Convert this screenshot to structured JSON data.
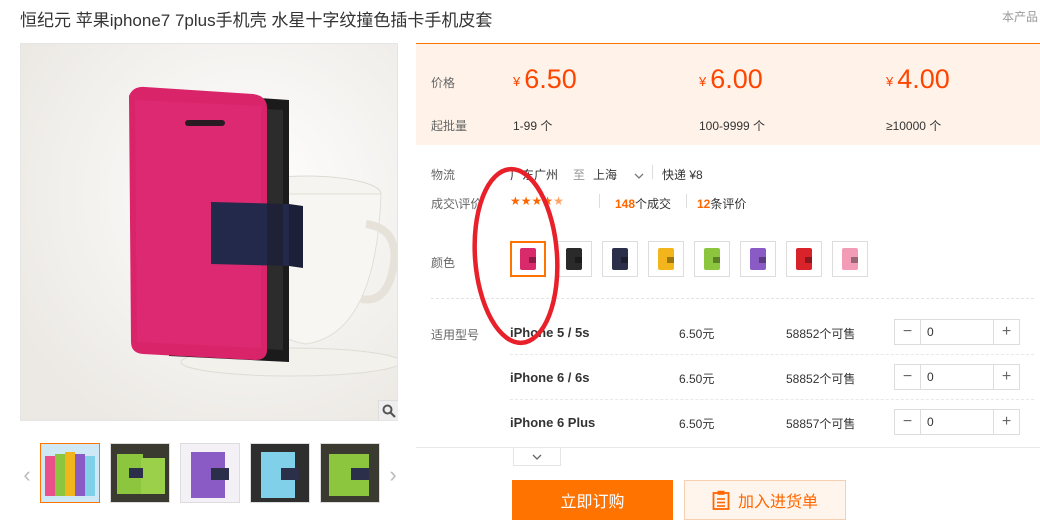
{
  "title": "恒纪元 苹果iphone7 7plus手机壳 水星十字纹撞色插卡手机皮套",
  "top_link": "本产品",
  "price_label": "价格",
  "moq_label": "起批量",
  "tiers": [
    {
      "currency": "¥",
      "price": "6.50",
      "qty": "1-99 个"
    },
    {
      "currency": "¥",
      "price": "6.00",
      "qty": "100-9999 个"
    },
    {
      "currency": "¥",
      "price": "4.00",
      "qty": "≥10000 个"
    }
  ],
  "logistics": {
    "label": "物流",
    "origin": "广东广州",
    "to": "至",
    "destination": "上海",
    "shipping": "快递 ¥8"
  },
  "rating": {
    "label": "成交\\评价",
    "stars": 4.5,
    "deals_num": "148",
    "deals_suffix": "个成交",
    "reviews_num": "12",
    "reviews_suffix": "条评价"
  },
  "color_label": "颜色",
  "swatches": [
    {
      "name": "rose",
      "color": "#d92a6b",
      "selected": true
    },
    {
      "name": "black",
      "color": "#2a2a2a"
    },
    {
      "name": "navy",
      "color": "#2b2f4a"
    },
    {
      "name": "yellow",
      "color": "#f2b51b"
    },
    {
      "name": "green",
      "color": "#8cc63f"
    },
    {
      "name": "purple",
      "color": "#8a5bc4"
    },
    {
      "name": "red",
      "color": "#d8232a"
    },
    {
      "name": "pink",
      "color": "#f29cb8"
    }
  ],
  "model_label": "适用型号",
  "models": [
    {
      "name": "iPhone 5 / 5s",
      "price": "6.50元",
      "stock": "58852个可售",
      "qty": "0"
    },
    {
      "name": "iPhone 6 / 6s",
      "price": "6.50元",
      "stock": "58852个可售",
      "qty": "0"
    },
    {
      "name": "iPhone 6 Plus",
      "price": "6.50元",
      "stock": "58857个可售",
      "qty": "0"
    }
  ],
  "buy_label": "立即订购",
  "cart_label": "加入进货单",
  "thumbs": [
    "#8cc63f",
    "#8cc63f",
    "#8a5bc4",
    "#7fd0e8",
    "#8cc63f"
  ],
  "colors": {
    "accent": "#ff7300",
    "price": "#ff4400",
    "price_bg": "#fff2e8",
    "annotation": "#e8202a"
  }
}
